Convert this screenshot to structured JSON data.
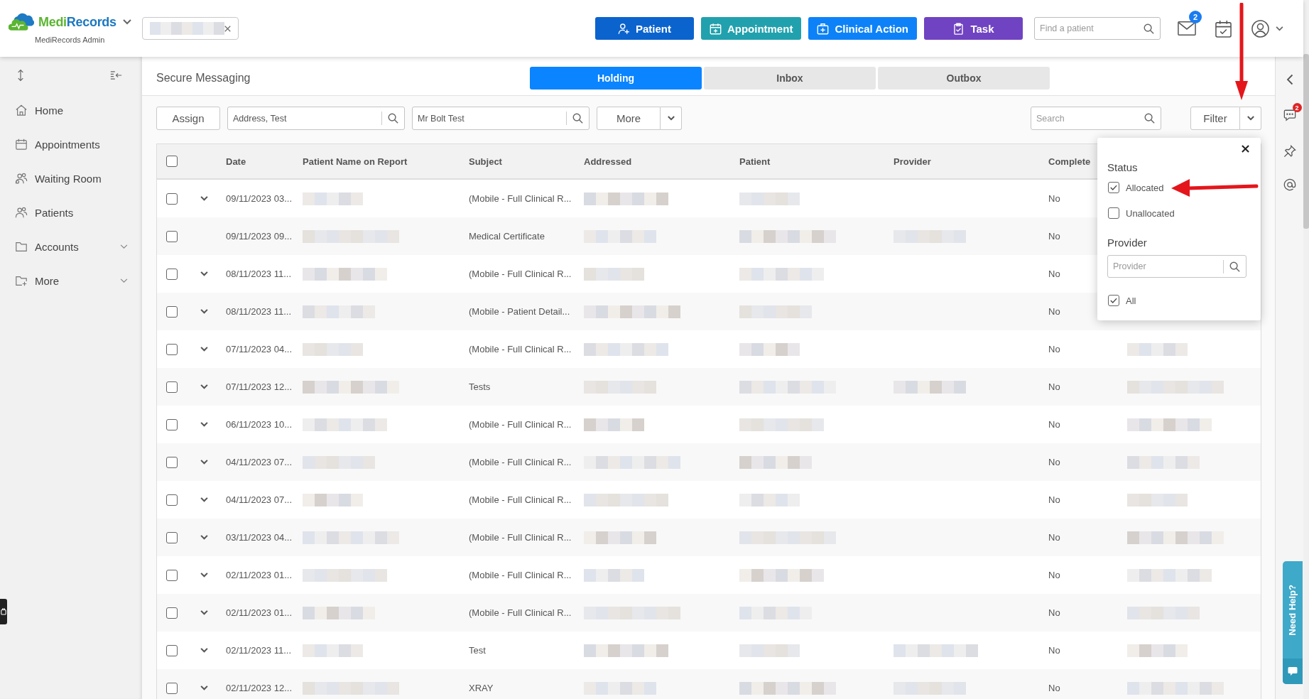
{
  "header": {
    "brand": {
      "first": "Medi",
      "second": "Records",
      "subtitle": "MediRecords Admin"
    },
    "actions": [
      {
        "label": "Patient",
        "kind": "patient",
        "color": "#0b63ce"
      },
      {
        "label": "Appointment",
        "kind": "appointment",
        "color": "#21a1ad"
      },
      {
        "label": "Clinical Action",
        "kind": "clinical",
        "color": "#0d82f8"
      },
      {
        "label": "Task",
        "kind": "task",
        "color": "#7043c2"
      }
    ],
    "search": {
      "placeholder": "Find a patient"
    },
    "mail_badge": "2"
  },
  "sidebar": {
    "items": [
      {
        "label": "Home",
        "kind": "home",
        "submenu": false
      },
      {
        "label": "Appointments",
        "kind": "appointments",
        "submenu": false
      },
      {
        "label": "Waiting Room",
        "kind": "waiting",
        "submenu": false
      },
      {
        "label": "Patients",
        "kind": "patients",
        "submenu": false
      },
      {
        "label": "Accounts",
        "kind": "accounts",
        "submenu": true
      },
      {
        "label": "More",
        "kind": "more",
        "submenu": true
      }
    ]
  },
  "page": {
    "title": "Secure Messaging",
    "tabs": [
      {
        "label": "Holding",
        "selected": true
      },
      {
        "label": "Inbox",
        "selected": false
      },
      {
        "label": "Outbox",
        "selected": false
      }
    ]
  },
  "toolbar": {
    "assign": "Assign",
    "address_field": {
      "value": "Address, Test"
    },
    "patient_field": {
      "value": "Mr Bolt Test"
    },
    "more": "More",
    "search": {
      "placeholder": "Search"
    },
    "filter": "Filter"
  },
  "table": {
    "select_all_checked": false,
    "columns": [
      "Date",
      "Patient Name on Report",
      "Subject",
      "Addressed",
      "Patient",
      "Provider",
      "Complete"
    ],
    "rows": [
      {
        "date": "09/11/2023 03...",
        "subject": "(Mobile - Full Clinical R...",
        "complete": "No",
        "checked": false,
        "expandable": true,
        "provider_redacted": false
      },
      {
        "date": "09/11/2023 09...",
        "subject": "Medical Certificate",
        "complete": "No",
        "checked": false,
        "expandable": false,
        "provider_redacted": true
      },
      {
        "date": "08/11/2023 11...",
        "subject": "(Mobile - Full Clinical R...",
        "complete": "No",
        "checked": false,
        "expandable": true,
        "provider_redacted": false
      },
      {
        "date": "08/11/2023 11...",
        "subject": "(Mobile - Patient Detail...",
        "complete": "No",
        "checked": false,
        "expandable": true,
        "provider_redacted": false
      },
      {
        "date": "07/11/2023 04...",
        "subject": "(Mobile - Full Clinical R...",
        "complete": "No",
        "checked": false,
        "expandable": true,
        "provider_redacted": false
      },
      {
        "date": "07/11/2023 12...",
        "subject": "Tests",
        "complete": "No",
        "checked": false,
        "expandable": true,
        "provider_redacted": true
      },
      {
        "date": "06/11/2023 10...",
        "subject": "(Mobile - Full Clinical R...",
        "complete": "No",
        "checked": false,
        "expandable": true,
        "provider_redacted": false
      },
      {
        "date": "04/11/2023 07...",
        "subject": "(Mobile - Full Clinical R...",
        "complete": "No",
        "checked": false,
        "expandable": true,
        "provider_redacted": false
      },
      {
        "date": "04/11/2023 07...",
        "subject": "(Mobile - Full Clinical R...",
        "complete": "No",
        "checked": false,
        "expandable": true,
        "provider_redacted": false
      },
      {
        "date": "03/11/2023 04...",
        "subject": "(Mobile - Full Clinical R...",
        "complete": "No",
        "checked": false,
        "expandable": true,
        "provider_redacted": false
      },
      {
        "date": "02/11/2023 01...",
        "subject": "(Mobile - Full Clinical R...",
        "complete": "No",
        "checked": false,
        "expandable": true,
        "provider_redacted": false
      },
      {
        "date": "02/11/2023 01...",
        "subject": "(Mobile - Full Clinical R...",
        "complete": "No",
        "checked": false,
        "expandable": true,
        "provider_redacted": false
      },
      {
        "date": "02/11/2023 11...",
        "subject": "Test",
        "complete": "No",
        "checked": false,
        "expandable": true,
        "provider_redacted": true
      },
      {
        "date": "02/11/2023 12...",
        "subject": "XRAY",
        "complete": "No",
        "checked": false,
        "expandable": true,
        "provider_redacted": true
      }
    ]
  },
  "filter_popup": {
    "status_heading": "Status",
    "status_options": [
      {
        "label": "Allocated",
        "checked": true
      },
      {
        "label": "Unallocated",
        "checked": false
      }
    ],
    "provider_heading": "Provider",
    "provider_search": {
      "placeholder": "Provider"
    },
    "provider_options": [
      {
        "label": "All",
        "checked": true
      }
    ]
  },
  "right_rail": {
    "chat_badge": "2"
  },
  "help_tab": {
    "label": "Need Help?"
  },
  "annotations": [
    {
      "kind": "down-arrow"
    },
    {
      "kind": "left-arrow"
    }
  ]
}
